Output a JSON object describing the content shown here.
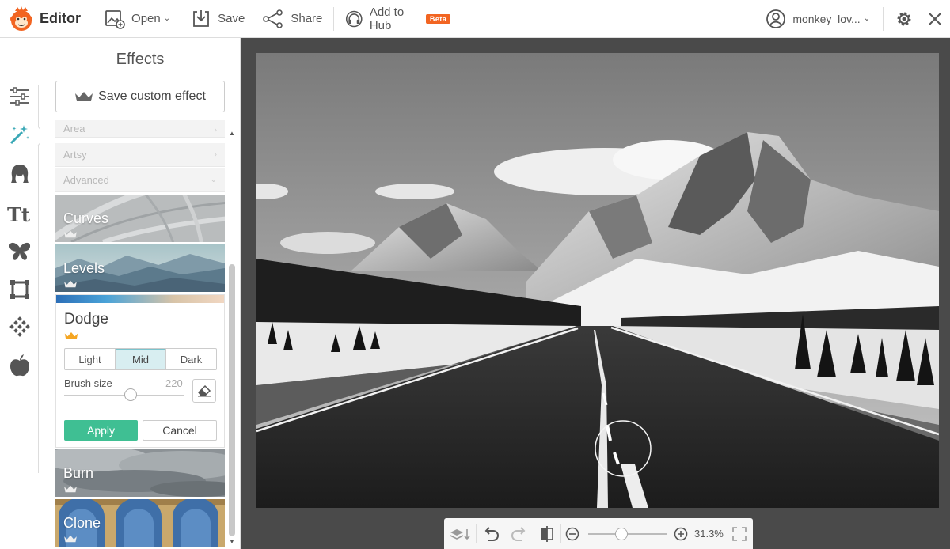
{
  "topbar": {
    "app_name": "Editor",
    "open_label": "Open",
    "save_label": "Save",
    "share_label": "Share",
    "hub_label": "Add to Hub",
    "beta_label": "Beta",
    "username": "monkey_lov..."
  },
  "rail": {
    "icons": [
      "adjust-icon",
      "effects-wand-icon",
      "touch-up-icon",
      "text-icon",
      "overlays-butterfly-icon",
      "frames-icon",
      "textures-icon",
      "seasonal-apple-icon"
    ],
    "active": "effects-wand-icon"
  },
  "panel": {
    "title": "Effects",
    "save_custom_label": "Save custom effect",
    "categories": [
      {
        "label": "Area"
      },
      {
        "label": "Artsy"
      },
      {
        "label": "Advanced"
      }
    ],
    "tiles": {
      "curves": "Curves",
      "levels": "Levels",
      "burn": "Burn",
      "clone": "Clone"
    },
    "dodge": {
      "title": "Dodge",
      "modes": [
        "Light",
        "Mid",
        "Dark"
      ],
      "active_mode": "Mid",
      "brush_size_label": "Brush size",
      "brush_size_value": "220",
      "brush_size_max": 400,
      "apply_label": "Apply",
      "cancel_label": "Cancel"
    }
  },
  "workspace": {
    "zoom": "31.3%"
  },
  "colors": {
    "accent": "#3fbf93",
    "beta": "#f26522",
    "logo": "#f26522",
    "workspace_bg": "#4a4a4a",
    "active_icon": "#3aa8b6"
  }
}
